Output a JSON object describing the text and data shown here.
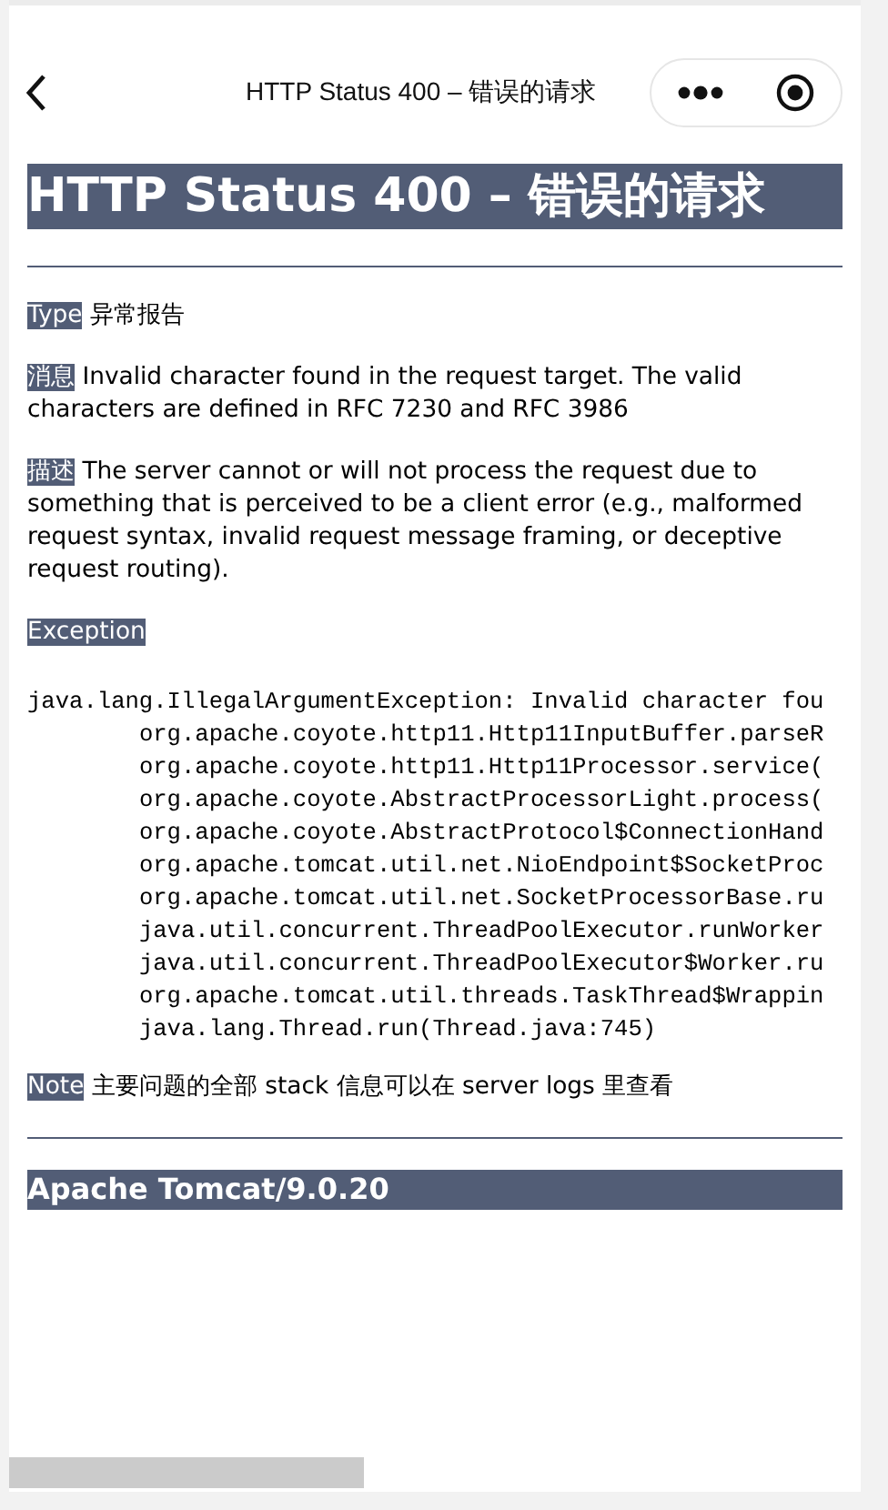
{
  "nav_bar": {
    "title": "HTTP Status 400 – 错误的请求"
  },
  "heading": "HTTP Status 400 – 错误的请求",
  "fields": [
    {
      "label": "Type",
      "text": "异常报告"
    },
    {
      "label": "消息",
      "text": "Invalid character found in the request target. The valid characters are defined in RFC 7230 and RFC 3986"
    },
    {
      "label": "描述",
      "text": "The server cannot or will not process the request due to something that is perceived to be a client error (e.g., malformed request syntax, invalid request message framing, or deceptive request routing)."
    }
  ],
  "exception": {
    "label": "Exception",
    "lines": [
      "java.lang.IllegalArgumentException: Invalid character fou",
      "\torg.apache.coyote.http11.Http11InputBuffer.parseR",
      "\torg.apache.coyote.http11.Http11Processor.service(",
      "\torg.apache.coyote.AbstractProcessorLight.process(",
      "\torg.apache.coyote.AbstractProtocol$ConnectionHand",
      "\torg.apache.tomcat.util.net.NioEndpoint$SocketProc",
      "\torg.apache.tomcat.util.net.SocketProcessorBase.ru",
      "\tjava.util.concurrent.ThreadPoolExecutor.runWorker",
      "\tjava.util.concurrent.ThreadPoolExecutor$Worker.ru",
      "\torg.apache.tomcat.util.threads.TaskThread$Wrappin",
      "\tjava.lang.Thread.run(Thread.java:745)"
    ]
  },
  "note": {
    "label": "Note",
    "text": "主要问题的全部 stack 信息可以在 server logs 里查看"
  },
  "footer": "Apache Tomcat/9.0.20"
}
